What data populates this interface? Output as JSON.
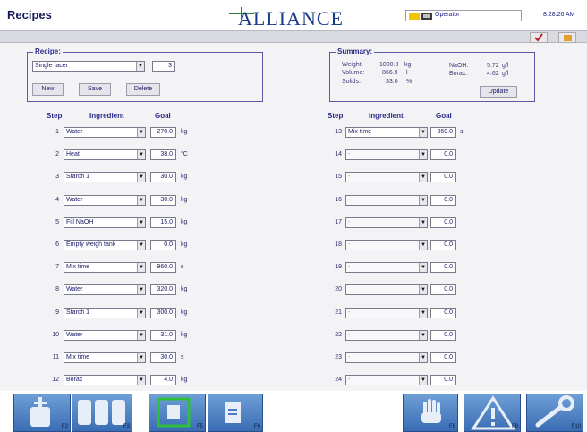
{
  "app": {
    "title": "Recipes",
    "logo_text": "ALLIANCE",
    "operator": "Operator",
    "clock": "8:28:26 AM"
  },
  "recipe": {
    "group_title": "Recipe:",
    "selected": "Single facer",
    "number": "3",
    "buttons": {
      "new": "New",
      "save": "Save",
      "delete": "Delete"
    }
  },
  "summary": {
    "group_title": "Summary:",
    "weight_label": "Weight:",
    "weight_value": "1000.0",
    "weight_unit": "kg",
    "volume_label": "Volume:",
    "volume_value": "866.9",
    "volume_unit": "l",
    "solids_label": "Solids:",
    "solids_value": "33.0",
    "solids_unit": "%",
    "naoh_label": "NaOH:",
    "naoh_value": "5.72",
    "naoh_unit": "g/l",
    "borax_label": "Borax:",
    "borax_value": "4.62",
    "borax_unit": "g/l",
    "update_button": "Update"
  },
  "headers": {
    "step": "Step",
    "ingredient": "Ingredient",
    "goal": "Goal"
  },
  "steps_left": [
    {
      "step": "1",
      "ingredient": "Water",
      "goal": "270.0",
      "unit": "kg"
    },
    {
      "step": "2",
      "ingredient": "Heat",
      "goal": "38.0",
      "unit": "°C"
    },
    {
      "step": "3",
      "ingredient": "Starch 1",
      "goal": "30.0",
      "unit": "kg"
    },
    {
      "step": "4",
      "ingredient": "Water",
      "goal": "30.0",
      "unit": "kg"
    },
    {
      "step": "5",
      "ingredient": "Fill NaOH",
      "goal": "15.0",
      "unit": "kg"
    },
    {
      "step": "6",
      "ingredient": "Empty weigh tank",
      "goal": "0.0",
      "unit": "kg"
    },
    {
      "step": "7",
      "ingredient": "Mix time",
      "goal": "960.0",
      "unit": "s"
    },
    {
      "step": "8",
      "ingredient": "Water",
      "goal": "320.0",
      "unit": "kg"
    },
    {
      "step": "9",
      "ingredient": "Starch 1",
      "goal": "300.0",
      "unit": "kg"
    },
    {
      "step": "10",
      "ingredient": "Water",
      "goal": "31.0",
      "unit": "kg"
    },
    {
      "step": "11",
      "ingredient": "Mix time",
      "goal": "30.0",
      "unit": "s"
    },
    {
      "step": "12",
      "ingredient": "Borax",
      "goal": "4.0",
      "unit": "kg"
    }
  ],
  "steps_right": [
    {
      "step": "13",
      "ingredient": "Mix time",
      "goal": "360.0",
      "unit": "s"
    },
    {
      "step": "14",
      "ingredient": "-",
      "goal": "0.0",
      "unit": ""
    },
    {
      "step": "15",
      "ingredient": "-",
      "goal": "0.0",
      "unit": ""
    },
    {
      "step": "16",
      "ingredient": "-",
      "goal": "0.0",
      "unit": ""
    },
    {
      "step": "17",
      "ingredient": "-",
      "goal": "0.0",
      "unit": ""
    },
    {
      "step": "18",
      "ingredient": "-",
      "goal": "0.0",
      "unit": ""
    },
    {
      "step": "19",
      "ingredient": "-",
      "goal": "0.0",
      "unit": ""
    },
    {
      "step": "20",
      "ingredient": "",
      "goal": "0.0",
      "unit": ""
    },
    {
      "step": "21",
      "ingredient": "-",
      "goal": "0.0",
      "unit": ""
    },
    {
      "step": "22",
      "ingredient": "-",
      "goal": "0.0",
      "unit": ""
    },
    {
      "step": "23",
      "ingredient": "-",
      "goal": "0.0",
      "unit": ""
    },
    {
      "step": "24",
      "ingredient": "-",
      "goal": "0.0",
      "unit": ""
    }
  ],
  "fkeys": [
    {
      "label": "F2",
      "icon": "mixer-tank-icon"
    },
    {
      "label": "F3",
      "icon": "tanks-icon"
    },
    {
      "label": "F5",
      "icon": "recipe-frame-icon"
    },
    {
      "label": "F6",
      "icon": "document-icon"
    },
    {
      "label": "F8",
      "icon": "hand-stop-icon"
    },
    {
      "label": "F9",
      "icon": "warning-icon"
    },
    {
      "label": "F10",
      "icon": "wrench-icon"
    }
  ],
  "colors": {
    "accent": "#2a2a8a",
    "fkey_blue": "#4a7cc4",
    "logo_green": "#2e7d3a"
  }
}
